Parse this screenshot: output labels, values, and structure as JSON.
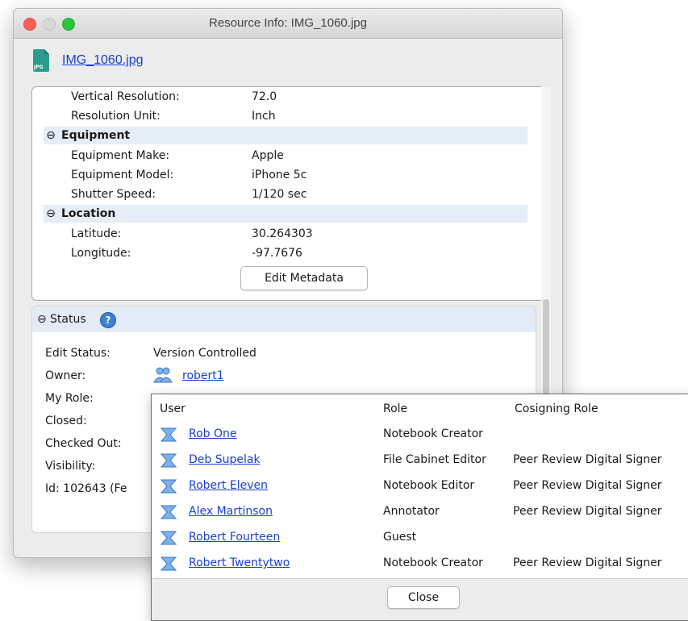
{
  "window": {
    "title": "Resource Info: IMG_1060.jpg"
  },
  "file": {
    "name": "IMG_1060.jpg",
    "icon_label": "JPG",
    "icon_color": "#2a9d8f"
  },
  "metadata": {
    "rows_top": [
      {
        "label": "Vertical Resolution:",
        "value": "72.0"
      },
      {
        "label": "Resolution Unit:",
        "value": "Inch"
      }
    ],
    "equipment": {
      "section": "Equipment",
      "toggle": "⊖",
      "rows": [
        {
          "label": "Equipment Make:",
          "value": "Apple"
        },
        {
          "label": "Equipment Model:",
          "value": "iPhone 5c"
        },
        {
          "label": "Shutter Speed:",
          "value": "1/120 sec"
        }
      ]
    },
    "location": {
      "section": "Location",
      "toggle": "⊖",
      "rows": [
        {
          "label": "Latitude:",
          "value": "30.264303"
        },
        {
          "label": "Longitude:",
          "value": "-97.7676"
        }
      ]
    },
    "edit_button": "Edit Metadata"
  },
  "status": {
    "toggle": "⊖",
    "title": "Status",
    "help_icon": "?",
    "rows": [
      {
        "label": "Edit Status:",
        "value": "Version Controlled"
      },
      {
        "label": "Owner:",
        "value": "robert1"
      },
      {
        "label": "My Role:",
        "value": ""
      },
      {
        "label": "Closed:",
        "value": ""
      },
      {
        "label": "Checked Out:",
        "value": ""
      },
      {
        "label": "Visibility:",
        "value": ""
      },
      {
        "label": "Id: 102643 (Fe",
        "value": ""
      }
    ]
  },
  "popup": {
    "headers": {
      "user": "User",
      "role": "Role",
      "cosign": "Cosigning Role"
    },
    "users": [
      {
        "name": "Rob One",
        "role": "Notebook Creator",
        "cosign": ""
      },
      {
        "name": "Deb Supelak",
        "role": "File Cabinet Editor",
        "cosign": "Peer Review Digital Signer"
      },
      {
        "name": "Robert Eleven",
        "role": "Notebook Editor",
        "cosign": "Peer Review Digital Signer"
      },
      {
        "name": "Alex Martinson",
        "role": "Annotator",
        "cosign": "Peer Review Digital Signer"
      },
      {
        "name": "Robert Fourteen",
        "role": "Guest",
        "cosign": ""
      },
      {
        "name": "Robert Twentytwo",
        "role": "Notebook Creator",
        "cosign": "Peer Review Digital Signer"
      }
    ],
    "close_button": "Close"
  },
  "colors": {
    "link": "#1a3fd0",
    "section_band": "#e5edf6",
    "user_icon": "#4a90e2"
  }
}
